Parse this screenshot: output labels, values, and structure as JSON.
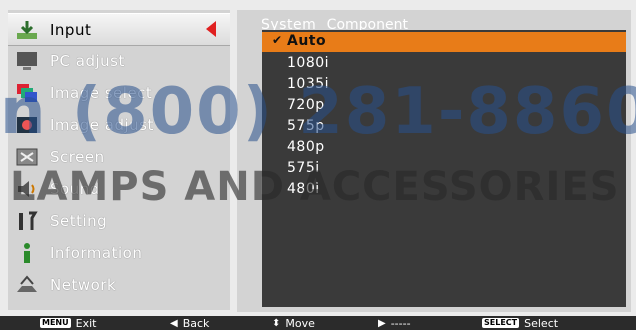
{
  "menu": {
    "items": [
      {
        "label": "Input",
        "icon": "input-icon",
        "active": true
      },
      {
        "label": "PC adjust",
        "icon": "monitor-icon"
      },
      {
        "label": "Image select",
        "icon": "image-select-icon"
      },
      {
        "label": "Image adjust",
        "icon": "image-adjust-icon"
      },
      {
        "label": "Screen",
        "icon": "screen-icon"
      },
      {
        "label": "Sound",
        "icon": "speaker-icon"
      },
      {
        "label": "Setting",
        "icon": "setting-icon"
      },
      {
        "label": "Information",
        "icon": "info-icon"
      },
      {
        "label": "Network",
        "icon": "network-icon"
      }
    ]
  },
  "panel": {
    "header_label": "System",
    "header_value": "Component",
    "options": [
      "Auto",
      "1080i",
      "1035i",
      "720p",
      "575p",
      "480p",
      "575i",
      "480i"
    ],
    "selected_index": 0,
    "check_glyph": "✔"
  },
  "footer": {
    "exit_key": "MENU",
    "exit_label": "Exit",
    "back_label": "Back",
    "move_label": "Move",
    "next_label": "-----",
    "select_key": "SELECT",
    "select_label": "Select"
  },
  "watermark": {
    "line1": "n (800) 281-8860",
    "line2": "LAMPS AND ACCESSORIES"
  },
  "colors": {
    "highlight": "#e87c18",
    "arrow": "#e02020",
    "panel_dark": "#3a3a3a"
  }
}
